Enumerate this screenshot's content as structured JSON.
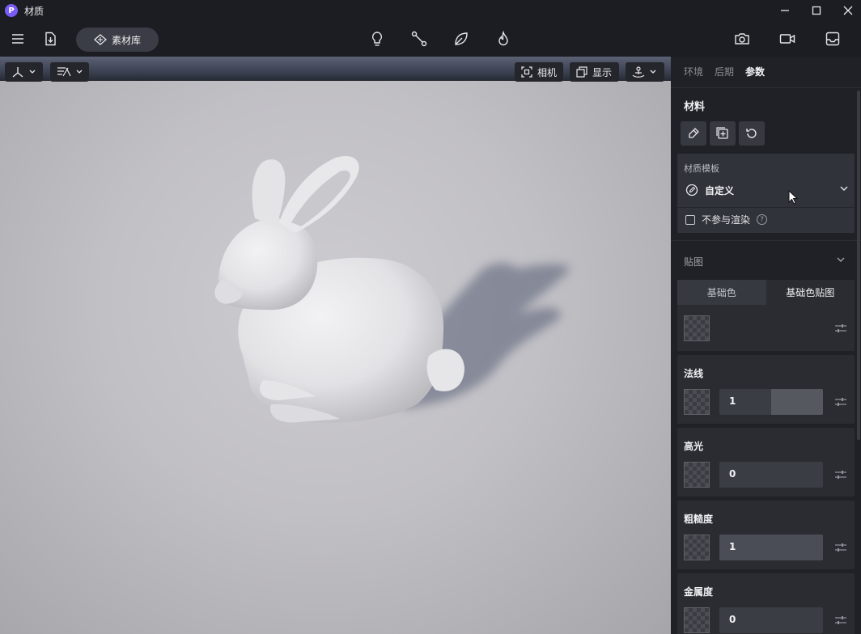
{
  "window": {
    "title": "材质",
    "logo_letter": "P"
  },
  "toolbar": {
    "library_label": "素材库"
  },
  "viewport": {
    "camera_label": "相机",
    "display_label": "显示"
  },
  "panel": {
    "tabs": [
      {
        "label": "环境",
        "active": false
      },
      {
        "label": "后期",
        "active": false
      },
      {
        "label": "参数",
        "active": true
      }
    ],
    "section_title": "材料",
    "template": {
      "label": "材质模板",
      "value": "自定义",
      "no_render_label": "不参与渲染",
      "help": "?"
    },
    "maps_title": "贴图",
    "base_color": {
      "tab1": "基础色",
      "tab2": "基础色贴图",
      "active_tab": "基础色贴图"
    },
    "properties": [
      {
        "label": "法线",
        "value": "1",
        "fill": 0.5
      },
      {
        "label": "高光",
        "value": "0",
        "fill": 0
      },
      {
        "label": "粗糙度",
        "value": "1",
        "fill": 1
      },
      {
        "label": "金属度",
        "value": "0",
        "fill": 0
      }
    ]
  },
  "colors": {
    "accent": "#7a5cf5",
    "panel_bg": "#1f2126",
    "app_bg": "#1b1d22"
  }
}
